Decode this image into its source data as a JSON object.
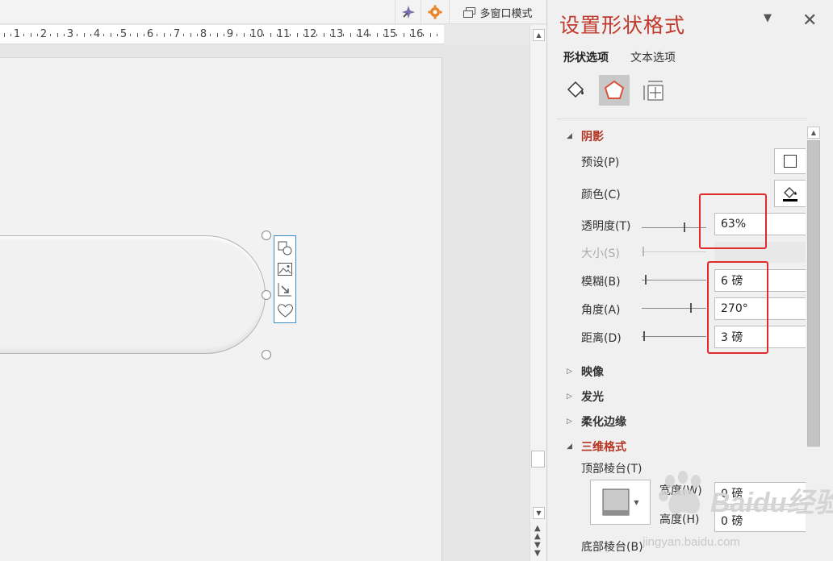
{
  "toolbar": {
    "multi_window_label": "多窗口模式",
    "wand_icon": "magic-wand-icon",
    "gear_icon": "gear-icon",
    "window_icon": "window-icon"
  },
  "ruler": {
    "numbers": [
      "1",
      "2",
      "3",
      "4",
      "5",
      "6",
      "7",
      "8",
      "9",
      "10",
      "11",
      "12",
      "13",
      "14",
      "15",
      "16"
    ]
  },
  "pane": {
    "title": "设置形状格式",
    "close_glyph": "✕",
    "dropdown_glyph": "▼",
    "tabs": {
      "shape_options": "形状选项",
      "text_options": "文本选项"
    },
    "category_icons": [
      "fill-line-icon",
      "effects-icon",
      "size-properties-icon"
    ],
    "shadow": {
      "header": "阴影",
      "preset_label": "预设(P)",
      "color_label": "颜色(C)",
      "transparency_label": "透明度(T)",
      "transparency_value": "63%",
      "transparency_fraction": 0.63,
      "size_label": "大小(S)",
      "blur_label": "模糊(B)",
      "blur_value": "6 磅",
      "blur_fraction": 0.05,
      "angle_label": "角度(A)",
      "angle_value": "270°",
      "angle_fraction": 0.75,
      "distance_label": "距离(D)",
      "distance_value": "3 磅",
      "distance_fraction": 0.02
    },
    "sections": {
      "reflection": "映像",
      "glow": "发光",
      "soft_edges": "柔化边缘",
      "three_d_format": "三维格式"
    },
    "three_d": {
      "top_bevel_label": "顶部棱台(T)",
      "width_label": "宽度(W)",
      "width_value": "0 磅",
      "height_label": "高度(H)",
      "height_value": "0 磅",
      "bottom_bevel_label": "底部棱台(B)"
    }
  },
  "watermark": {
    "brand": "Baidu经验",
    "url": "jingyan.baidu.com"
  },
  "colors": {
    "accent_red": "#b53321",
    "highlight_box": "#e02b2b",
    "selection_blue": "#3b8bc4"
  }
}
